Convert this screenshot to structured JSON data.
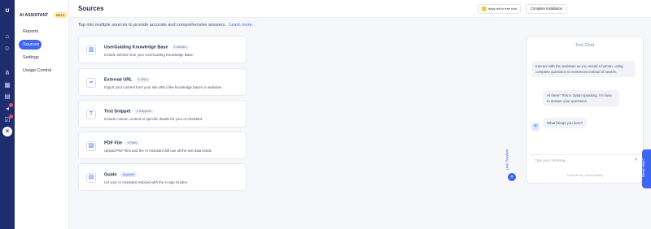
{
  "rail": {
    "icons": [
      "logo-icon",
      "home-icon",
      "users-icon",
      "route-icon",
      "grid-icon",
      "book-icon",
      "megaphone-icon",
      "checklist-icon",
      "ai-assistant-icon"
    ]
  },
  "subnav": {
    "title": "AI ASSISTANT",
    "badge": "BETA",
    "items": [
      {
        "label": "Reports"
      },
      {
        "label": "Sources"
      },
      {
        "label": "Settings"
      },
      {
        "label": "Usage Control"
      }
    ]
  },
  "header": {
    "title": "Sources",
    "trial_text": "days left in free trial",
    "trial_days": "7",
    "complete_label": "Complete Installation"
  },
  "intro": {
    "text": "Tap into multiple sources to provide accurate and comprehensive answers.",
    "link": "Learn more."
  },
  "sources": [
    {
      "name": "UserGuiding Knowledge Base",
      "badge": "2 articles",
      "desc": "Include articles from your UserGuiding Knowledge Base.",
      "icon": "book-icon"
    },
    {
      "name": "External URL",
      "badge": "0 URLs",
      "desc": "Import your content from your site URLs like knowledge bases or websites.",
      "icon": "link-icon"
    },
    {
      "name": "Text Snippet",
      "badge": "0 Snippets",
      "desc": "Include custom content or specific details for your AI Assistant.",
      "icon": "text-icon"
    },
    {
      "name": "PDF File",
      "badge": "0 Files",
      "desc": "Upload PDF files and the AI Assistant will use all the text data inside.",
      "icon": "pdf-icon"
    },
    {
      "name": "Guide",
      "badge": "Upgrade",
      "desc": "Let your AI Assistant respond with the in-app Guides.",
      "icon": "guide-icon"
    }
  ],
  "live_preview": "Live Preview",
  "chat": {
    "title": "Test Chat",
    "intro_bubble": "Interact with the assistant as you would a human, using complete questions or sentences instead of search.",
    "greet": "Hi there! This is Dylan speaking. I'm here to answer your questions.",
    "question": "What brings you here?",
    "placeholder": "Type your message...",
    "powered": "Powered by UserGuiding"
  },
  "help": "Need Help?"
}
